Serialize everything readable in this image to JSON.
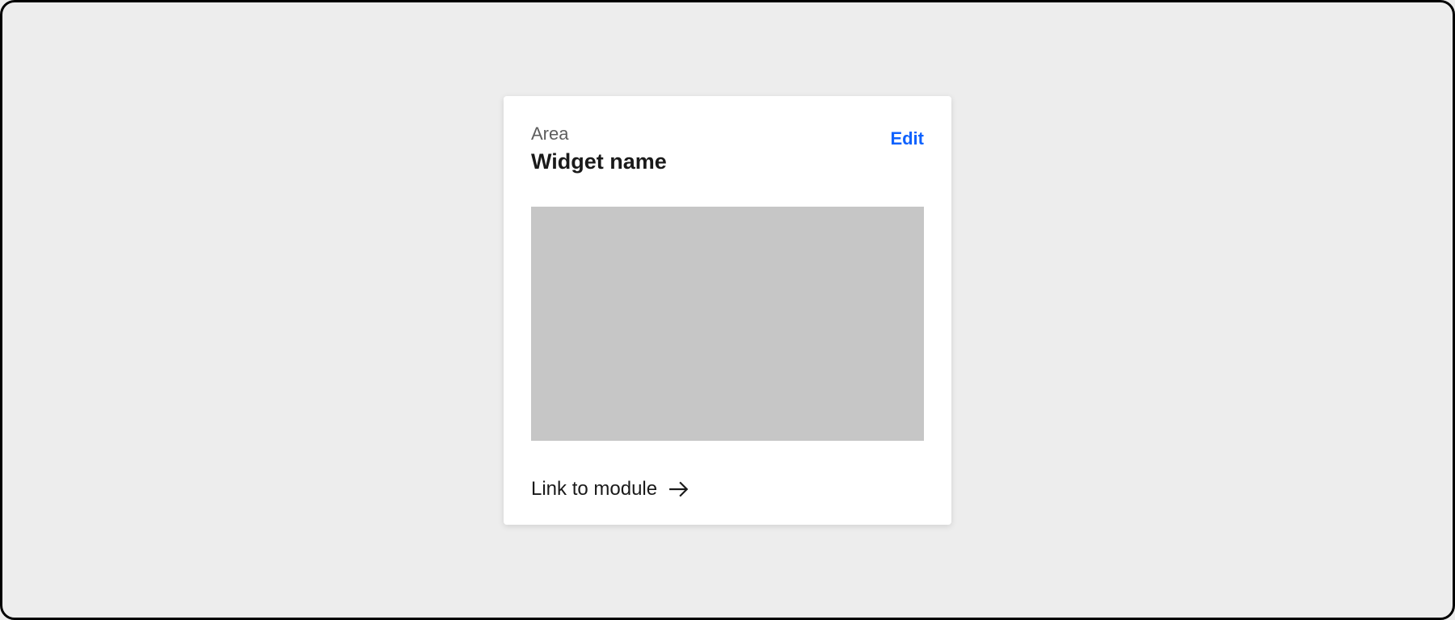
{
  "card": {
    "area_label": "Area",
    "widget_title": "Widget name",
    "edit_label": "Edit",
    "module_link_label": "Link to module"
  },
  "icons": {
    "arrow_right": "arrow-right-icon"
  },
  "colors": {
    "background": "#ededed",
    "card_bg": "#ffffff",
    "placeholder": "#c6c6c6",
    "accent": "#0f62fe",
    "text_muted": "#5e5e5e",
    "text_primary": "#1a1a1a"
  }
}
